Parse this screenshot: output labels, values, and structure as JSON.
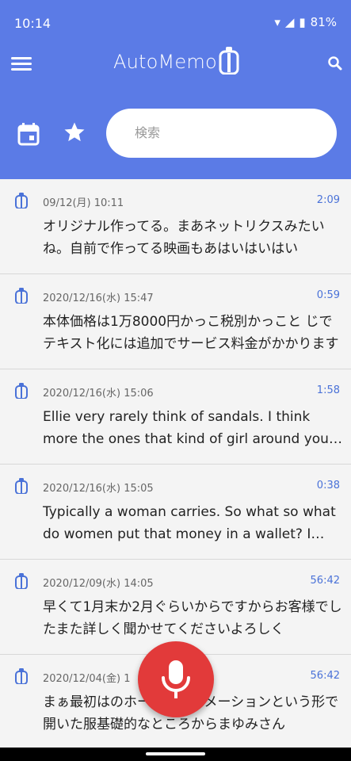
{
  "status": {
    "time": "10:14",
    "battery": "81%"
  },
  "app": {
    "title": "AutoMemo",
    "search_placeholder": "検索"
  },
  "items": [
    {
      "date": "09/12(月) 10:11",
      "duration": "2:09",
      "text": "オリジナル作ってる。まあネットリクスみたいね。自前で作ってる映画もあはいはいはい"
    },
    {
      "date": "2020/12/16(水) 15:47",
      "duration": "0:59",
      "text": "本体価格は1万8000円かっこ税別かっこと じでテキスト化には追加でサービス料金がかかります"
    },
    {
      "date": "2020/12/16(水) 15:06",
      "duration": "1:58",
      "text": "Ellie very rarely think of sandals. I think more the ones that kind of girl around your feet"
    },
    {
      "date": "2020/12/16(水) 15:05",
      "duration": "0:38",
      "text": "Typically a woman carries. So what so what do women put that money in a wallet? I think so"
    },
    {
      "date": "2020/12/09(水) 14:05",
      "duration": "56:42",
      "text": "早くて1月末か2月ぐらいからですからお客様でしたまた詳しく聞かせてくださいよろしく"
    },
    {
      "date": "2020/12/04(金) 1",
      "duration": "56:42",
      "text": "まぁ最初はのホームオートメーションという形で開いた服基礎的なところからまゆみさん"
    }
  ]
}
